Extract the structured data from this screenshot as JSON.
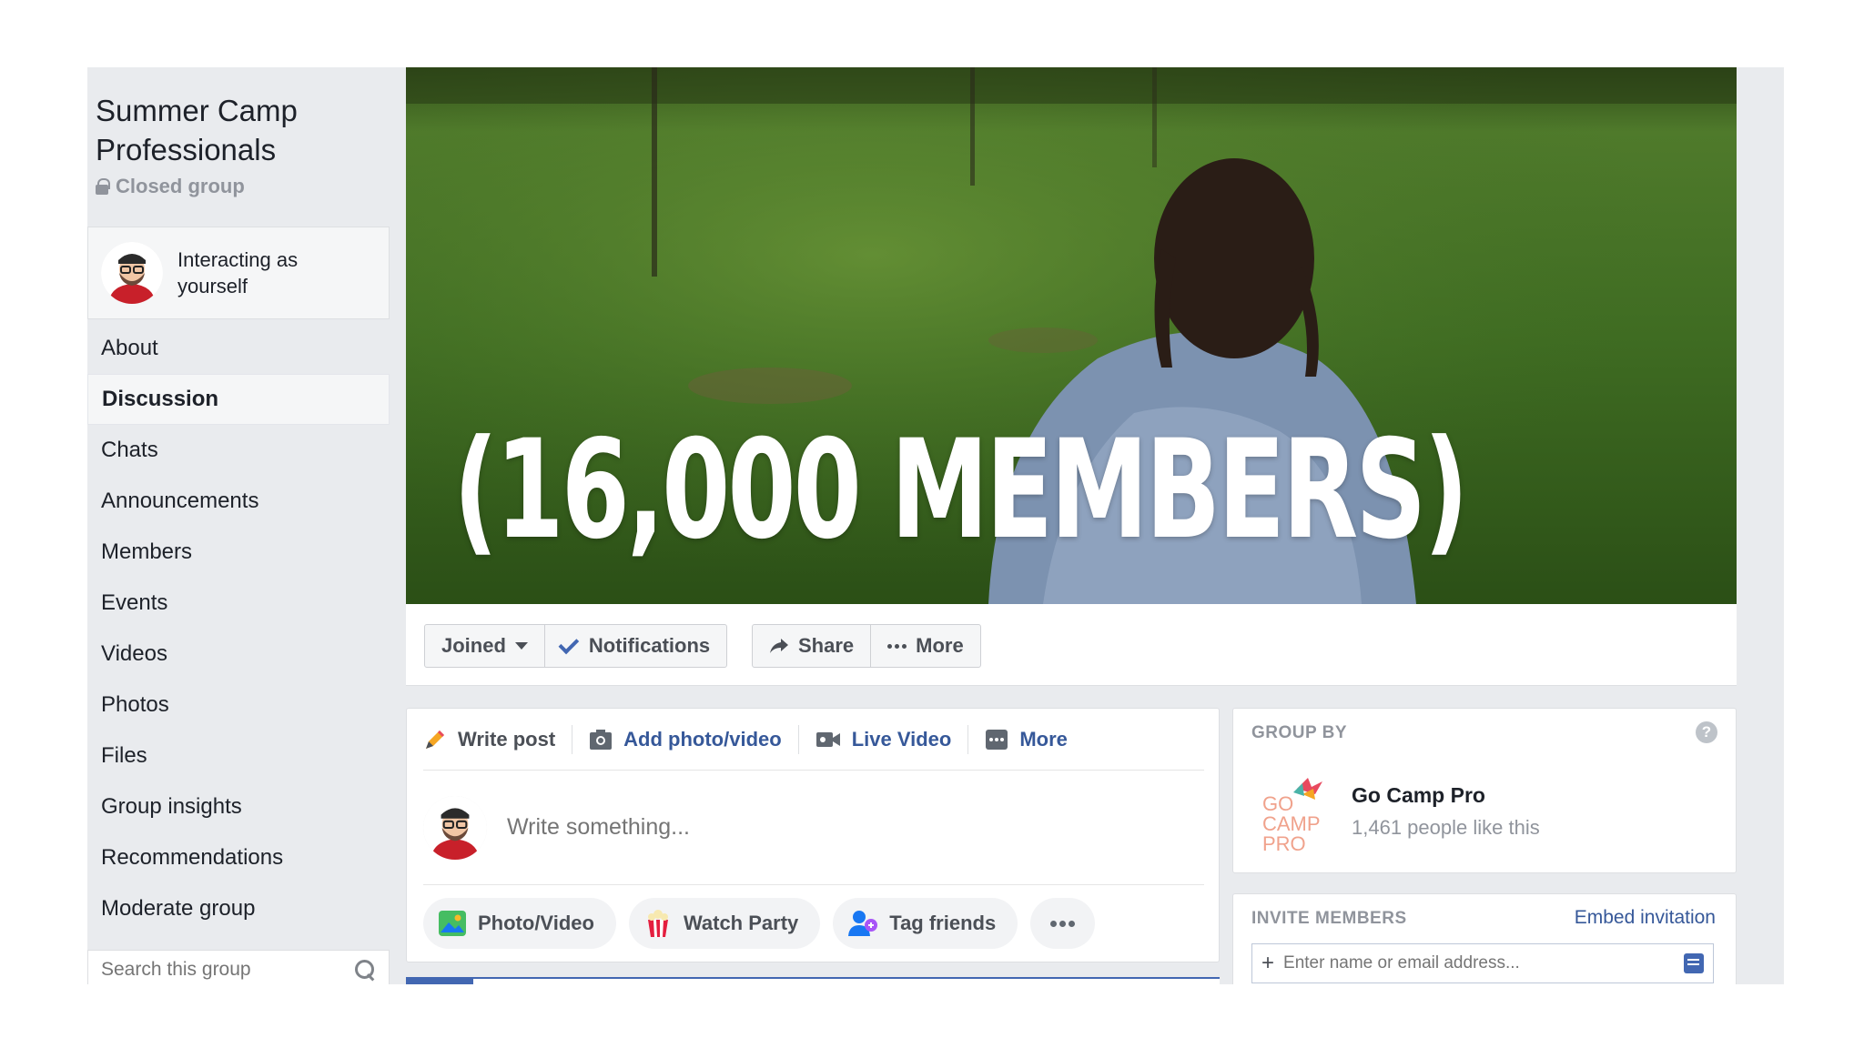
{
  "group": {
    "name": "Summer Camp Professionals",
    "privacy": "Closed group",
    "interacting_as": "Interacting as yourself"
  },
  "nav": {
    "items": [
      "About",
      "Discussion",
      "Chats",
      "Announcements",
      "Members",
      "Events",
      "Videos",
      "Photos",
      "Files",
      "Group insights",
      "Recommendations",
      "Moderate group"
    ],
    "active": "Discussion"
  },
  "search": {
    "placeholder": "Search this group"
  },
  "cover": {
    "caption": "(16,000 MEMBERS)"
  },
  "actions": {
    "joined": "Joined",
    "notifications": "Notifications",
    "share": "Share",
    "more": "More"
  },
  "composer": {
    "tabs": {
      "write_post": "Write post",
      "add_photo": "Add photo/video",
      "live_video": "Live Video",
      "more": "More"
    },
    "placeholder": "Write something...",
    "buttons": {
      "photo_video": "Photo/Video",
      "watch_party": "Watch Party",
      "tag_friends": "Tag friends"
    }
  },
  "group_by": {
    "heading": "GROUP BY",
    "help": "?",
    "page_name": "Go Camp Pro",
    "page_likes": "1,461 people like this",
    "logo_text": [
      "GO",
      "CAMP",
      "PRO"
    ]
  },
  "invite": {
    "heading": "INVITE MEMBERS",
    "embed": "Embed invitation",
    "placeholder": "Enter name or email address..."
  },
  "colors": {
    "fb_blue": "#4267b2",
    "link": "#365899",
    "bg": "#e9ebee"
  },
  "icons": [
    "lock-icon",
    "search-icon",
    "check-icon",
    "share-icon",
    "pencil-icon",
    "camera-icon",
    "video-icon",
    "photo-icon",
    "popcorn-icon",
    "tag-friends-icon",
    "help-icon",
    "plus-icon",
    "note-icon"
  ]
}
